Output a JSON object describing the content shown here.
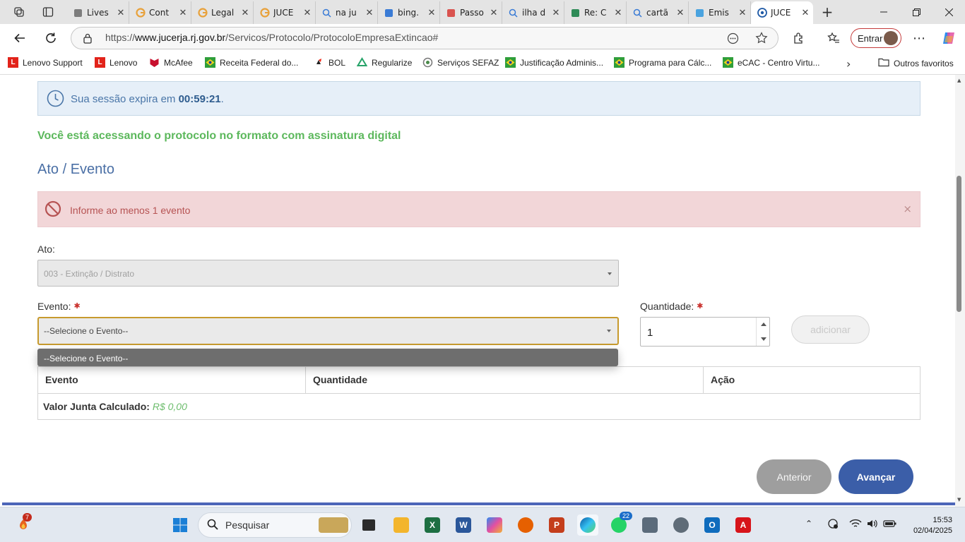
{
  "browser": {
    "tabs": [
      {
        "label": "Lives",
        "icon": "stream-icon"
      },
      {
        "label": "Cont",
        "icon": "google-icon"
      },
      {
        "label": "Legal",
        "icon": "google-icon"
      },
      {
        "label": "JUCE",
        "icon": "google-icon"
      },
      {
        "label": "na ju",
        "icon": "search-icon"
      },
      {
        "label": "bing.",
        "icon": "bing-icon"
      },
      {
        "label": "Passo",
        "icon": "pdf-icon"
      },
      {
        "label": "ilha d",
        "icon": "search-icon"
      },
      {
        "label": "Re: C",
        "icon": "mail-icon"
      },
      {
        "label": "cartã",
        "icon": "search-icon"
      },
      {
        "label": "Emis",
        "icon": "diamond-icon"
      },
      {
        "label": "JUCE",
        "icon": "jucerja-icon",
        "active": true
      }
    ],
    "url_prefix": "https://",
    "url_domain": "www.jucerja.rj.gov.br",
    "url_path": "/Servicos/Protocolo/ProtocoloEmpresaExtincao#",
    "signin_label": "Entrar",
    "bookmarks": [
      "Lenovo Support",
      "Lenovo",
      "McAfee",
      "Receita Federal do...",
      "BOL",
      "Regularize",
      "Serviços SEFAZ",
      "Justificação Adminis...",
      "Programa para Cálc...",
      "eCAC - Centro Virtu..."
    ],
    "other_favorites": "Outros favoritos"
  },
  "page": {
    "session_prefix": "Sua sessão expira em ",
    "session_time": "00:59:21",
    "session_suffix": ".",
    "signature_message": "Você está acessando o protocolo no formato com assinatura digital",
    "section_title": "Ato / Evento",
    "alert_message": "Informe ao menos 1 evento",
    "alert_close": "×",
    "ato_label": "Ato:",
    "ato_value": "003 - Extinção / Distrato",
    "evento_label": "Evento:",
    "evento_value": "--Selecione o Evento--",
    "evento_options": [
      "--Selecione o Evento--"
    ],
    "quantidade_label": "Quantidade:",
    "quantidade_value": "1",
    "required_mark": "✱",
    "add_button": "adicionar",
    "table_headers": [
      "Evento",
      "Quantidade",
      "Ação"
    ],
    "total_label": "Valor Junta Calculado:",
    "total_value": "R$ 0,00",
    "prev_button": "Anterior",
    "next_button": "Avançar"
  },
  "taskbar": {
    "search_placeholder": "Pesquisar",
    "weather_badge": "7",
    "whatsapp_badge": "22",
    "time": "15:53",
    "date": "02/04/2025"
  },
  "colors": {
    "success_green": "#5cb85c",
    "alert_bg": "#f2d6d8",
    "alert_text": "#b65353",
    "primary_blue": "#3b5ea8",
    "focus_border": "#c79a2e"
  }
}
